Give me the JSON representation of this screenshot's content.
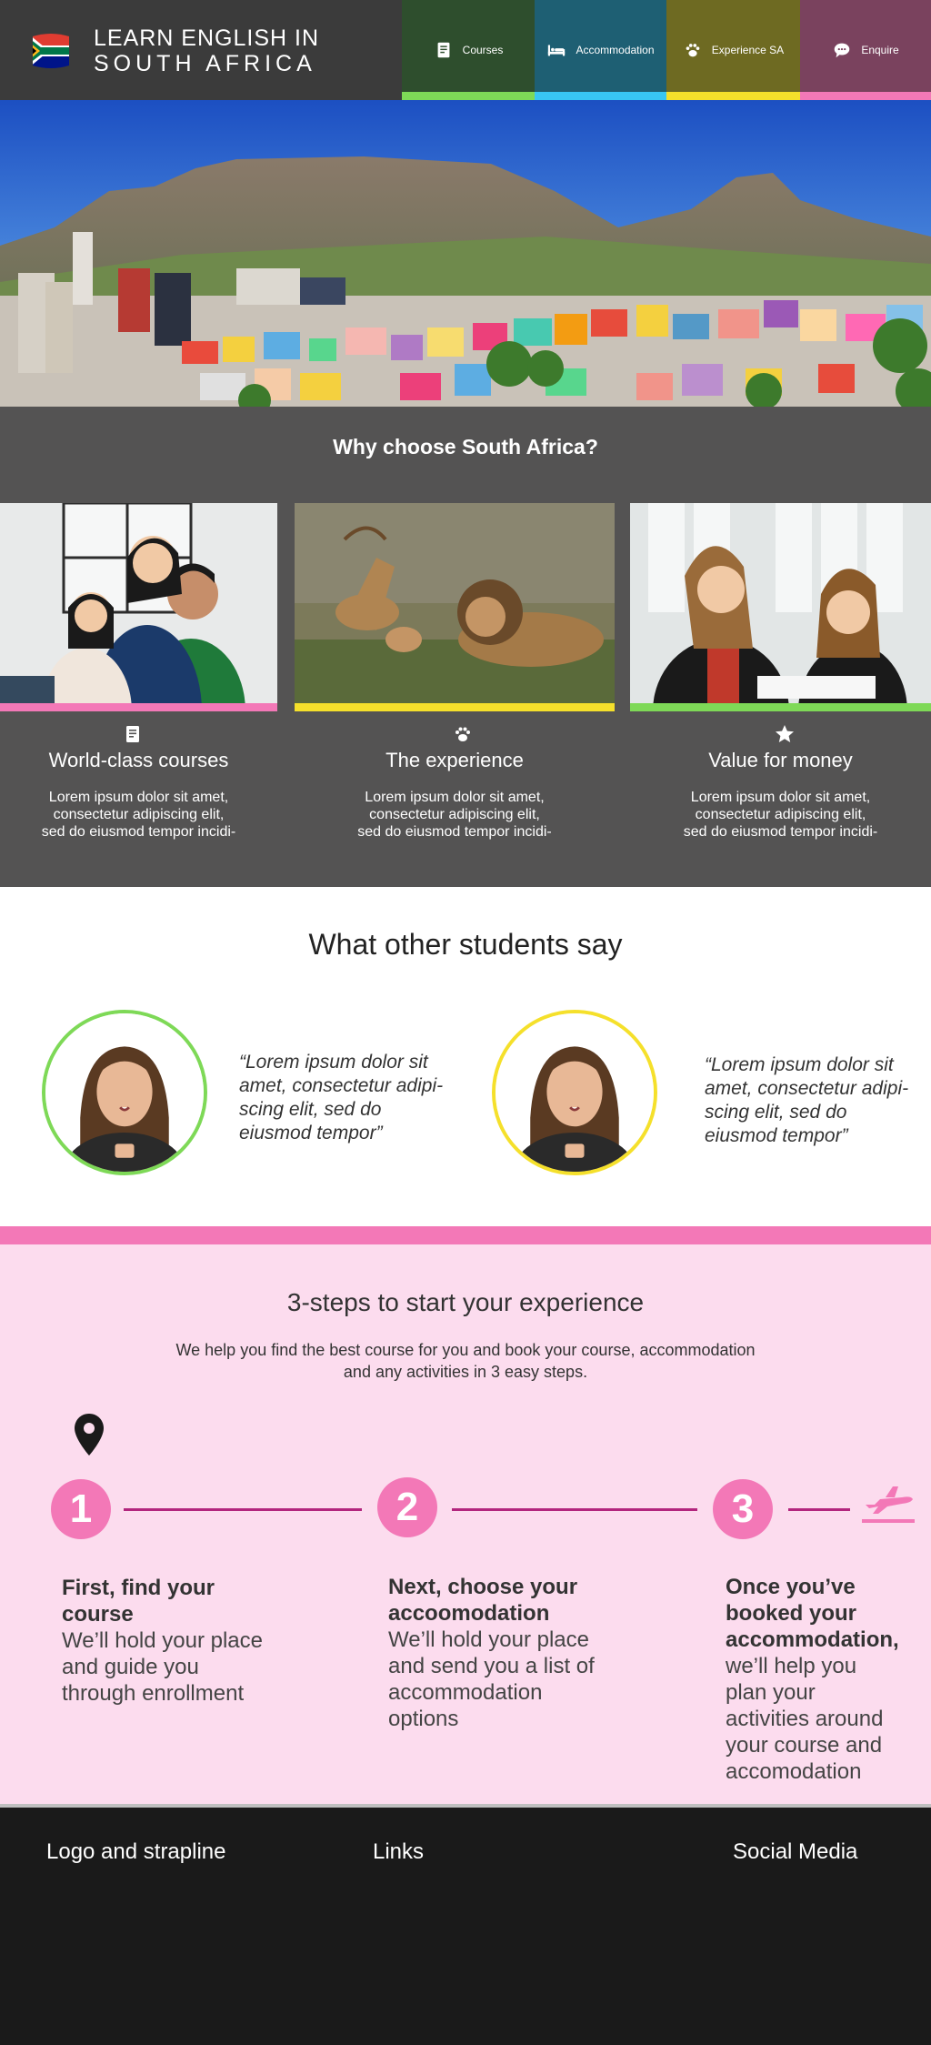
{
  "brand": {
    "line1": "LEARN ENGLISH IN",
    "line2": "SOUTH AFRICA"
  },
  "nav": [
    {
      "label": "Courses",
      "icon": "book-icon",
      "color": "#2e4e2d",
      "accent": "#7ed957"
    },
    {
      "label": "Accommodation",
      "icon": "bed-icon",
      "color": "#1e5f73",
      "accent": "#38c6f4"
    },
    {
      "label": "Experience SA",
      "icon": "paw-icon",
      "color": "#6e6a22",
      "accent": "#f5e02b"
    },
    {
      "label": "Enquire",
      "icon": "chat-icon",
      "color": "#7a425e",
      "accent": "#f378b7"
    }
  ],
  "why": {
    "title": "Why choose South Africa?",
    "cards": [
      {
        "title": "World-class courses",
        "icon": "book-icon",
        "accent": "#f378b7",
        "text_lines": [
          "Lorem ipsum dolor sit amet,",
          "consectetur adipiscing elit,",
          "sed do eiusmod tempor incidi-"
        ]
      },
      {
        "title": "The experience",
        "icon": "paw-icon",
        "accent": "#f5e02b",
        "text_lines": [
          "Lorem ipsum dolor sit amet,",
          "consectetur adipiscing elit,",
          "sed do eiusmod tempor incidi-"
        ]
      },
      {
        "title": "Value for money",
        "icon": "star-icon",
        "accent": "#7ed957",
        "text_lines": [
          "Lorem ipsum dolor sit amet,",
          "consectetur adipiscing elit,",
          "sed do eiusmod tempor incidi-"
        ]
      }
    ]
  },
  "testimonials": {
    "title": "What other students say",
    "items": [
      {
        "ring": "#7ed957",
        "quote_lines": [
          "“Lorem ipsum dolor sit",
          "amet, consectetur adipi-",
          "scing elit, sed do",
          "eiusmod tempor”"
        ]
      },
      {
        "ring": "#f5e02b",
        "quote_lines": [
          "“Lorem ipsum dolor sit",
          "amet, consectetur adipi-",
          "scing elit, sed do",
          "eiusmod tempor”"
        ]
      }
    ]
  },
  "steps": {
    "title": "3-steps to start your experience",
    "subtitle_lines": [
      "We help you find the best course for you and book your course, accommodation",
      "and any activities in 3 easy steps."
    ],
    "items": [
      {
        "num": "1",
        "heading_lines": [
          "First, find your",
          "course"
        ],
        "text_lines": [
          "We’ll hold your place",
          "and guide you",
          "through enrollment"
        ]
      },
      {
        "num": "2",
        "heading_lines": [
          "Next, choose your",
          "accoomodation"
        ],
        "text_lines": [
          "We’ll hold your place",
          "and send you a list of",
          "accommodation",
          "options"
        ]
      },
      {
        "num": "3",
        "heading_lines": [
          "Once you’ve",
          "booked your",
          "accommodation,"
        ],
        "text_lines": [
          "we’ll help you",
          "plan your",
          "activities around",
          "your course and",
          "accomodation"
        ]
      }
    ]
  },
  "footer": {
    "col1": "Logo and strapline",
    "col2": "Links",
    "col3": "Social Media"
  }
}
